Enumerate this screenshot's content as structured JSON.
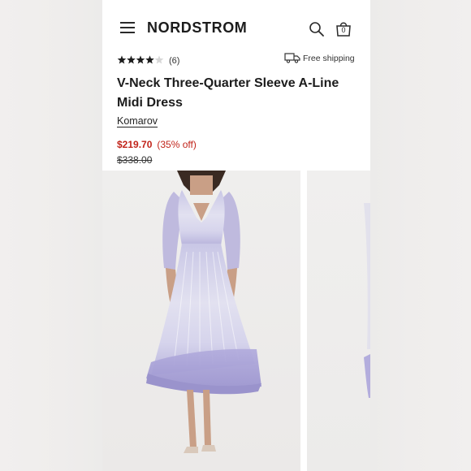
{
  "header": {
    "brand": "NORDSTROM",
    "bag_count": "0"
  },
  "product": {
    "rating": 4,
    "rating_max": 5,
    "review_count": "(6)",
    "shipping_label": "Free shipping",
    "title": "V-Neck Three-Quarter Sleeve A-Line Midi Dress",
    "brand": "Komarov",
    "sale_price": "$219.70",
    "discount": "(35% off)",
    "original_price": "$338.00"
  },
  "gallery": {
    "images": [
      "model-front-photo",
      "model-side-photo"
    ]
  },
  "colors": {
    "sale": "#c1241a",
    "dress_lavender": "#a9a4d8",
    "background": "#ffffff"
  }
}
